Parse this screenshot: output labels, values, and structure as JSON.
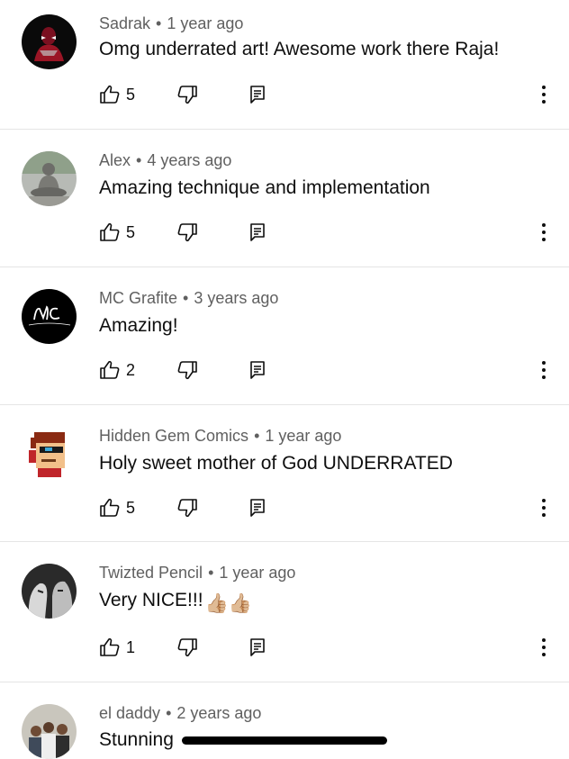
{
  "comments": [
    {
      "author": "Sadrak",
      "separator": "•",
      "time": "1 year ago",
      "text": "Omg underrated art! Awesome work there Raja!",
      "likes": "5",
      "avatar_icon": "masked-figure-avatar"
    },
    {
      "author": "Alex",
      "separator": "•",
      "time": "4 years ago",
      "text": "Amazing technique and implementation",
      "likes": "5",
      "avatar_icon": "buddha-statue-avatar"
    },
    {
      "author": "MC Grafite",
      "separator": "•",
      "time": "3 years ago",
      "text": "Amazing!",
      "likes": "2",
      "avatar_icon": "mc-logo-avatar"
    },
    {
      "author": "Hidden Gem Comics",
      "separator": "•",
      "time": "1 year ago",
      "text": "Holy sweet mother of God UNDERRATED",
      "likes": "5",
      "avatar_icon": "pixel-character-avatar"
    },
    {
      "author": "Twizted Pencil",
      "separator": "•",
      "time": "1 year ago",
      "text": "Very NICE!!!",
      "text_emoji": "👍🏼👍🏼",
      "likes": "1",
      "avatar_icon": "faces-sketch-avatar"
    },
    {
      "author": "el daddy",
      "separator": "•",
      "time": "2 years ago",
      "text": "Stunning",
      "avatar_icon": "group-photo-avatar"
    }
  ],
  "icons": {
    "like": "thumbs-up-icon",
    "dislike": "thumbs-down-icon",
    "reply": "reply-icon",
    "more": "more-vertical-icon"
  },
  "colors": {
    "text": "#0f0f0f",
    "meta": "#606060",
    "divider": "#e5e5e5"
  }
}
